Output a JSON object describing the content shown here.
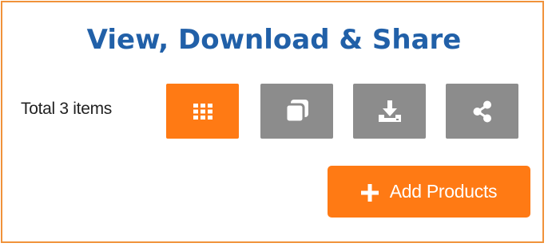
{
  "title": "View, Download & Share",
  "item_count_text": "Total 3 items",
  "toolbar": {
    "grid_view": {
      "icon": "grid-icon",
      "color": "#FF7A14",
      "active": true
    },
    "copy": {
      "icon": "copy-icon",
      "color": "#8C8C8C"
    },
    "download": {
      "icon": "download-icon",
      "color": "#8C8C8C"
    },
    "share": {
      "icon": "share-icon",
      "color": "#8C8C8C"
    }
  },
  "add_button": {
    "icon": "plus-icon",
    "label": "Add Products",
    "color": "#FF7A14"
  },
  "colors": {
    "frame_border": "#F0923A",
    "title": "#2160A8",
    "accent": "#FF7A14",
    "neutral_button": "#8C8C8C"
  }
}
